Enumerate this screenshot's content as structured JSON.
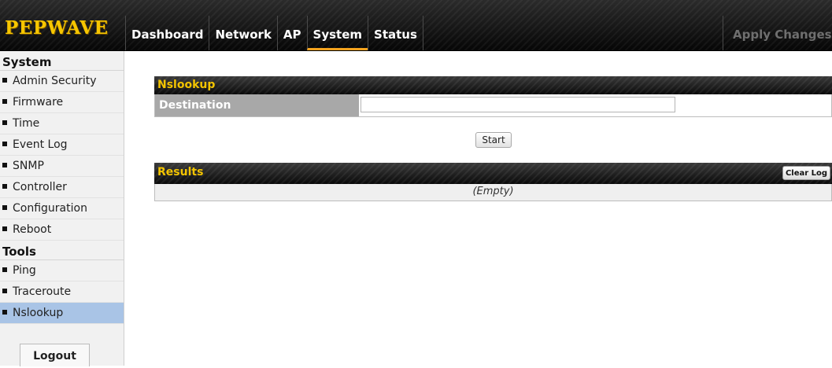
{
  "brand": {
    "logo": "PEPWAVE"
  },
  "nav": {
    "tabs": [
      {
        "label": "Dashboard"
      },
      {
        "label": "Network"
      },
      {
        "label": "AP"
      },
      {
        "label": "System",
        "active": true
      },
      {
        "label": "Status"
      }
    ],
    "apply_changes": "Apply Changes"
  },
  "sidebar": {
    "sections": [
      {
        "title": "System",
        "items": [
          {
            "label": "Admin Security"
          },
          {
            "label": "Firmware"
          },
          {
            "label": "Time"
          },
          {
            "label": "Event Log"
          },
          {
            "label": "SNMP"
          },
          {
            "label": "Controller"
          },
          {
            "label": "Configuration"
          },
          {
            "label": "Reboot"
          }
        ]
      },
      {
        "title": "Tools",
        "items": [
          {
            "label": "Ping"
          },
          {
            "label": "Traceroute"
          },
          {
            "label": "Nslookup",
            "active": true
          }
        ]
      }
    ],
    "logout": "Logout"
  },
  "nslookup": {
    "title": "Nslookup",
    "destination_label": "Destination",
    "destination_value": "",
    "start_button": "Start"
  },
  "results": {
    "title": "Results",
    "clear_log_button": "Clear Log",
    "empty_text": "(Empty)"
  },
  "colors": {
    "logo": "#f7c600",
    "active_tab_underline": "#f3a21d",
    "panel_title": "#f3c400",
    "sidebar_active": "#a9c4e6",
    "row_label_bg": "#a8a8a8"
  }
}
